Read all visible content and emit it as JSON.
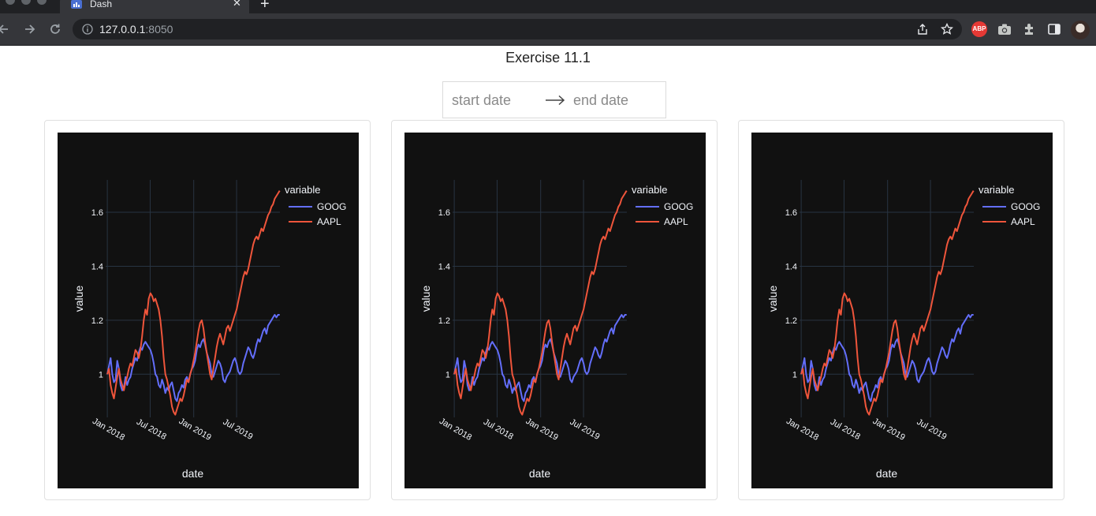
{
  "browser": {
    "tab_title": "Dash",
    "close_glyph": "✕",
    "new_tab_glyph": "+",
    "url_host": "127.0.0.1",
    "url_port": ":8050",
    "abp_label": "ABP"
  },
  "page": {
    "title": "Exercise 11.1",
    "date_range": {
      "start_placeholder": "start date",
      "end_placeholder": "end date"
    }
  },
  "chart_data": [
    {
      "type": "line",
      "xlabel": "date",
      "ylabel": "value",
      "legend_title": "variable",
      "legend_position": "top-right",
      "y_ticks": [
        1.0,
        1.2,
        1.4,
        1.6
      ],
      "y_tick_labels": [
        "1",
        "1.2",
        "1.4",
        "1.6"
      ],
      "x_ticks": [
        "2018-01-01",
        "2018-07-01",
        "2019-01-01",
        "2019-07-01"
      ],
      "x_tick_labels": [
        "Jan 2018",
        "Jul 2018",
        "Jan 2019",
        "Jul 2019"
      ],
      "grid": true,
      "theme": "dark",
      "series": [
        {
          "name": "GOOG",
          "color": "#636efa",
          "x": [
            "2018-01-01",
            "2018-01-08",
            "2018-01-15",
            "2018-01-22",
            "2018-01-29",
            "2018-02-05",
            "2018-02-12",
            "2018-02-19",
            "2018-02-26",
            "2018-03-05",
            "2018-03-12",
            "2018-03-19",
            "2018-03-26",
            "2018-04-02",
            "2018-04-09",
            "2018-04-16",
            "2018-04-23",
            "2018-04-30",
            "2018-05-07",
            "2018-05-14",
            "2018-05-21",
            "2018-05-28",
            "2018-06-04",
            "2018-06-11",
            "2018-06-18",
            "2018-06-25",
            "2018-07-02",
            "2018-07-09",
            "2018-07-16",
            "2018-07-23",
            "2018-07-30",
            "2018-08-06",
            "2018-08-13",
            "2018-08-20",
            "2018-08-27",
            "2018-09-03",
            "2018-09-10",
            "2018-09-17",
            "2018-09-24",
            "2018-10-01",
            "2018-10-08",
            "2018-10-15",
            "2018-10-22",
            "2018-10-29",
            "2018-11-05",
            "2018-11-12",
            "2018-11-19",
            "2018-11-26",
            "2018-12-03",
            "2018-12-10",
            "2018-12-17",
            "2018-12-24",
            "2018-12-31",
            "2019-01-07",
            "2019-01-14",
            "2019-01-21",
            "2019-01-28",
            "2019-02-04",
            "2019-02-11",
            "2019-02-18",
            "2019-02-25",
            "2019-03-04",
            "2019-03-11",
            "2019-03-18",
            "2019-03-25",
            "2019-04-01",
            "2019-04-08",
            "2019-04-15",
            "2019-04-22",
            "2019-04-29",
            "2019-05-06",
            "2019-05-13",
            "2019-05-20",
            "2019-05-27",
            "2019-06-03",
            "2019-06-10",
            "2019-06-17",
            "2019-06-24",
            "2019-07-01",
            "2019-07-08",
            "2019-07-15",
            "2019-07-22",
            "2019-07-29",
            "2019-08-05",
            "2019-08-12",
            "2019-08-19",
            "2019-08-26",
            "2019-09-02",
            "2019-09-09",
            "2019-09-16",
            "2019-09-23",
            "2019-09-30",
            "2019-10-07",
            "2019-10-14",
            "2019-10-21",
            "2019-10-28",
            "2019-11-04",
            "2019-11-11",
            "2019-11-18",
            "2019-11-25",
            "2019-12-02",
            "2019-12-09",
            "2019-12-16",
            "2019-12-23",
            "2019-12-30"
          ],
          "y": [
            1.0,
            1.03,
            1.06,
            1.0,
            0.97,
            0.98,
            1.05,
            1.02,
            0.96,
            0.94,
            0.95,
            0.99,
            0.96,
            0.98,
            0.99,
            1.02,
            1.04,
            1.06,
            1.05,
            1.08,
            1.1,
            1.09,
            1.11,
            1.12,
            1.11,
            1.1,
            1.09,
            1.07,
            1.04,
            1.0,
            0.99,
            0.96,
            0.95,
            0.98,
            0.96,
            0.93,
            0.95,
            0.94,
            0.96,
            0.97,
            0.94,
            0.91,
            0.9,
            0.93,
            0.94,
            0.96,
            0.95,
            0.98,
            0.99,
            0.97,
            1.0,
            1.02,
            1.03,
            1.05,
            1.09,
            1.11,
            1.1,
            1.12,
            1.13,
            1.11,
            1.08,
            1.06,
            1.04,
            1.0,
            0.99,
            1.01,
            1.03,
            1.05,
            1.04,
            1.02,
            0.98,
            0.97,
            0.99,
            1.0,
            1.01,
            1.03,
            1.05,
            1.06,
            1.04,
            1.01,
            1.0,
            1.01,
            1.04,
            1.06,
            1.08,
            1.1,
            1.09,
            1.07,
            1.06,
            1.08,
            1.11,
            1.13,
            1.12,
            1.14,
            1.16,
            1.17,
            1.15,
            1.18,
            1.19,
            1.2,
            1.21,
            1.22,
            1.21,
            1.22,
            1.22
          ]
        },
        {
          "name": "AAPL",
          "color": "#ef553b",
          "x": [
            "2018-01-01",
            "2018-01-08",
            "2018-01-15",
            "2018-01-22",
            "2018-01-29",
            "2018-02-05",
            "2018-02-12",
            "2018-02-19",
            "2018-02-26",
            "2018-03-05",
            "2018-03-12",
            "2018-03-19",
            "2018-03-26",
            "2018-04-02",
            "2018-04-09",
            "2018-04-16",
            "2018-04-23",
            "2018-04-30",
            "2018-05-07",
            "2018-05-14",
            "2018-05-21",
            "2018-05-28",
            "2018-06-04",
            "2018-06-11",
            "2018-06-18",
            "2018-06-25",
            "2018-07-02",
            "2018-07-09",
            "2018-07-16",
            "2018-07-23",
            "2018-07-30",
            "2018-08-06",
            "2018-08-13",
            "2018-08-20",
            "2018-08-27",
            "2018-09-03",
            "2018-09-10",
            "2018-09-17",
            "2018-09-24",
            "2018-10-01",
            "2018-10-08",
            "2018-10-15",
            "2018-10-22",
            "2018-10-29",
            "2018-11-05",
            "2018-11-12",
            "2018-11-19",
            "2018-11-26",
            "2018-12-03",
            "2018-12-10",
            "2018-12-17",
            "2018-12-24",
            "2018-12-31",
            "2019-01-07",
            "2019-01-14",
            "2019-01-21",
            "2019-01-28",
            "2019-02-04",
            "2019-02-11",
            "2019-02-18",
            "2019-02-25",
            "2019-03-04",
            "2019-03-11",
            "2019-03-18",
            "2019-03-25",
            "2019-04-01",
            "2019-04-08",
            "2019-04-15",
            "2019-04-22",
            "2019-04-29",
            "2019-05-06",
            "2019-05-13",
            "2019-05-20",
            "2019-05-27",
            "2019-06-03",
            "2019-06-10",
            "2019-06-17",
            "2019-06-24",
            "2019-07-01",
            "2019-07-08",
            "2019-07-15",
            "2019-07-22",
            "2019-07-29",
            "2019-08-05",
            "2019-08-12",
            "2019-08-19",
            "2019-08-26",
            "2019-09-02",
            "2019-09-09",
            "2019-09-16",
            "2019-09-23",
            "2019-09-30",
            "2019-10-07",
            "2019-10-14",
            "2019-10-21",
            "2019-10-28",
            "2019-11-04",
            "2019-11-11",
            "2019-11-18",
            "2019-11-25",
            "2019-12-02",
            "2019-12-09",
            "2019-12-16",
            "2019-12-23",
            "2019-12-30"
          ],
          "y": [
            1.0,
            1.02,
            0.96,
            0.93,
            0.91,
            0.95,
            0.99,
            1.02,
            0.98,
            0.96,
            0.94,
            0.97,
            0.99,
            1.02,
            1.04,
            1.03,
            1.06,
            1.09,
            1.08,
            1.06,
            1.09,
            1.14,
            1.2,
            1.24,
            1.22,
            1.28,
            1.3,
            1.29,
            1.27,
            1.28,
            1.26,
            1.24,
            1.2,
            1.14,
            1.06,
            1.0,
            0.98,
            0.95,
            0.92,
            0.88,
            0.86,
            0.85,
            0.87,
            0.89,
            0.91,
            0.9,
            0.92,
            0.95,
            0.98,
            0.97,
            1.0,
            1.02,
            1.05,
            1.08,
            1.12,
            1.16,
            1.19,
            1.2,
            1.17,
            1.12,
            1.08,
            1.04,
            1.0,
            0.98,
            1.02,
            1.06,
            1.1,
            1.13,
            1.15,
            1.13,
            1.11,
            1.14,
            1.17,
            1.18,
            1.16,
            1.18,
            1.2,
            1.22,
            1.24,
            1.27,
            1.3,
            1.33,
            1.36,
            1.38,
            1.37,
            1.39,
            1.42,
            1.45,
            1.48,
            1.5,
            1.51,
            1.5,
            1.52,
            1.54,
            1.53,
            1.55,
            1.57,
            1.59,
            1.6,
            1.62,
            1.63,
            1.65,
            1.66,
            1.67,
            1.68
          ]
        }
      ]
    }
  ]
}
